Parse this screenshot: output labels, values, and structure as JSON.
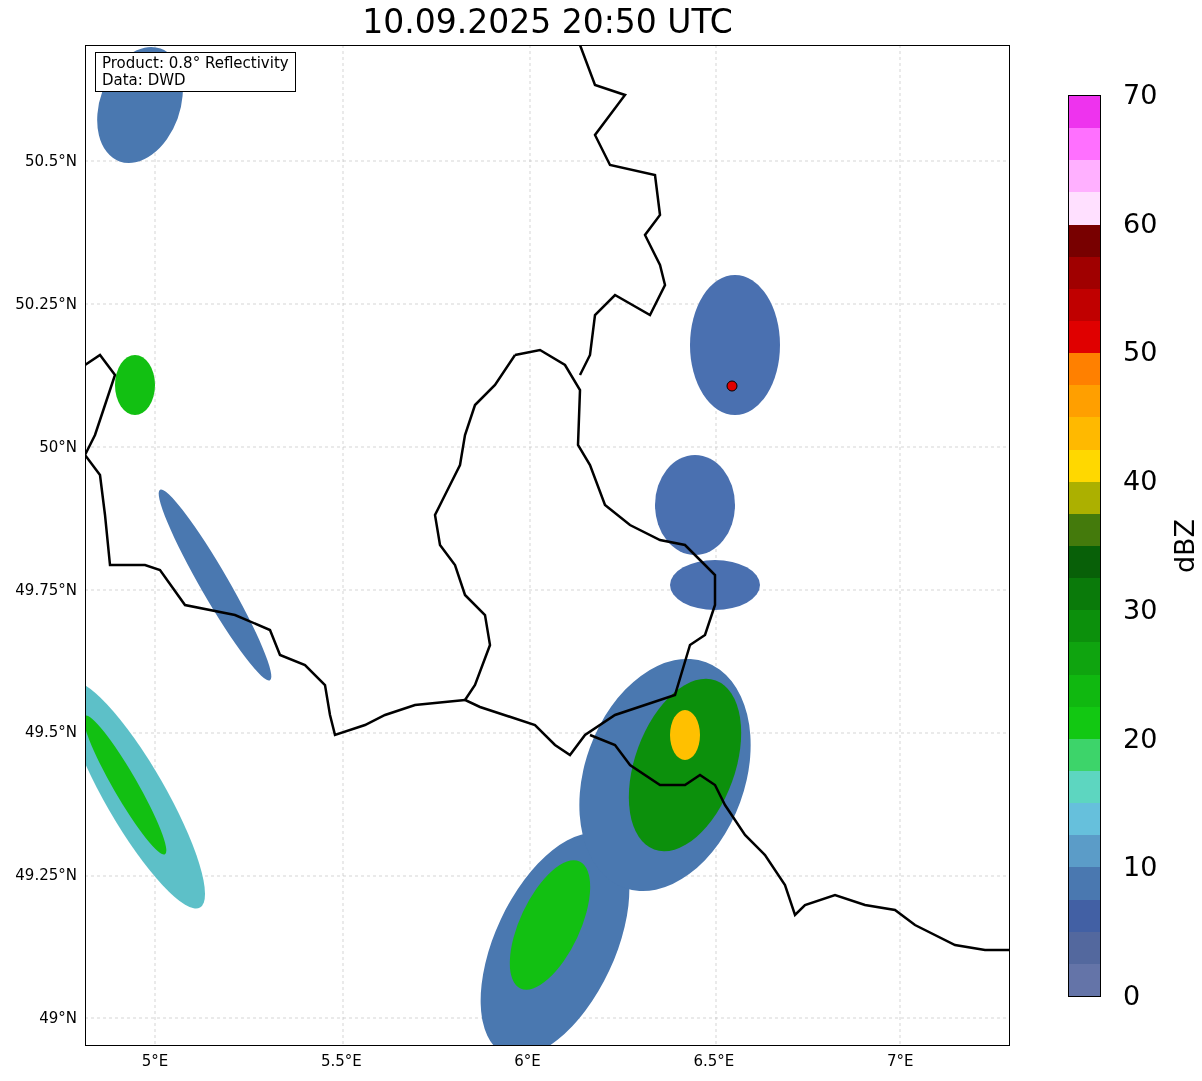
{
  "title": "10.09.2025 20:50 UTC",
  "info_box": {
    "lines": [
      "Product: 0.8° Reflectivity",
      "Data: DWD"
    ]
  },
  "map": {
    "y_ticks": [
      "50.5°N",
      "50.25°N",
      "50°N",
      "49.75°N",
      "49.5°N",
      "49.25°N",
      "49°N"
    ],
    "x_ticks": [
      "5°E",
      "5.5°E",
      "6°E",
      "6.5°E",
      "7°E"
    ]
  },
  "colorbar": {
    "label": "dBZ",
    "ticks": [
      "70",
      "60",
      "50",
      "40",
      "30",
      "20",
      "10",
      "0"
    ],
    "bands": [
      {
        "color": "#ee33ee"
      },
      {
        "color": "#ff70ff"
      },
      {
        "color": "#ffb0ff"
      },
      {
        "color": "#ffe0ff"
      },
      {
        "color": "#780000"
      },
      {
        "color": "#a00000"
      },
      {
        "color": "#c00000"
      },
      {
        "color": "#e00000"
      },
      {
        "color": "#ff8000"
      },
      {
        "color": "#ff9f00"
      },
      {
        "color": "#ffb900"
      },
      {
        "color": "#ffd800"
      },
      {
        "color": "#acb000"
      },
      {
        "color": "#447a0c"
      },
      {
        "color": "#086008"
      },
      {
        "color": "#0a7a0a"
      },
      {
        "color": "#0c900c"
      },
      {
        "color": "#0fa40f"
      },
      {
        "color": "#10b810"
      },
      {
        "color": "#12c812"
      },
      {
        "color": "#3dd46a"
      },
      {
        "color": "#5dd6c0"
      },
      {
        "color": "#66c0dc"
      },
      {
        "color": "#5b9cc8"
      },
      {
        "color": "#4a78b0"
      },
      {
        "color": "#4260a4"
      },
      {
        "color": "#53689e"
      },
      {
        "color": "#6474a8"
      }
    ]
  }
}
